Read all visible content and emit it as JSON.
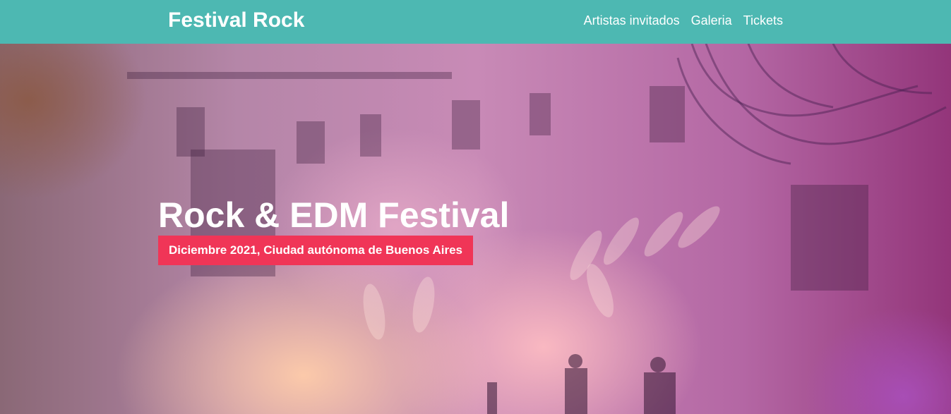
{
  "navbar": {
    "brand": "Festival Rock",
    "links": [
      {
        "label": "Artistas invitados"
      },
      {
        "label": "Galeria"
      },
      {
        "label": "Tickets"
      }
    ],
    "background_color": "#4db8b2"
  },
  "hero": {
    "title": "Rock & EDM Festival",
    "subtitle": "Diciembre 2021, Ciudad autónoma de Buenos Aires",
    "subtitle_background_color": "#f03557",
    "background_image": "concert-stage-photo"
  }
}
